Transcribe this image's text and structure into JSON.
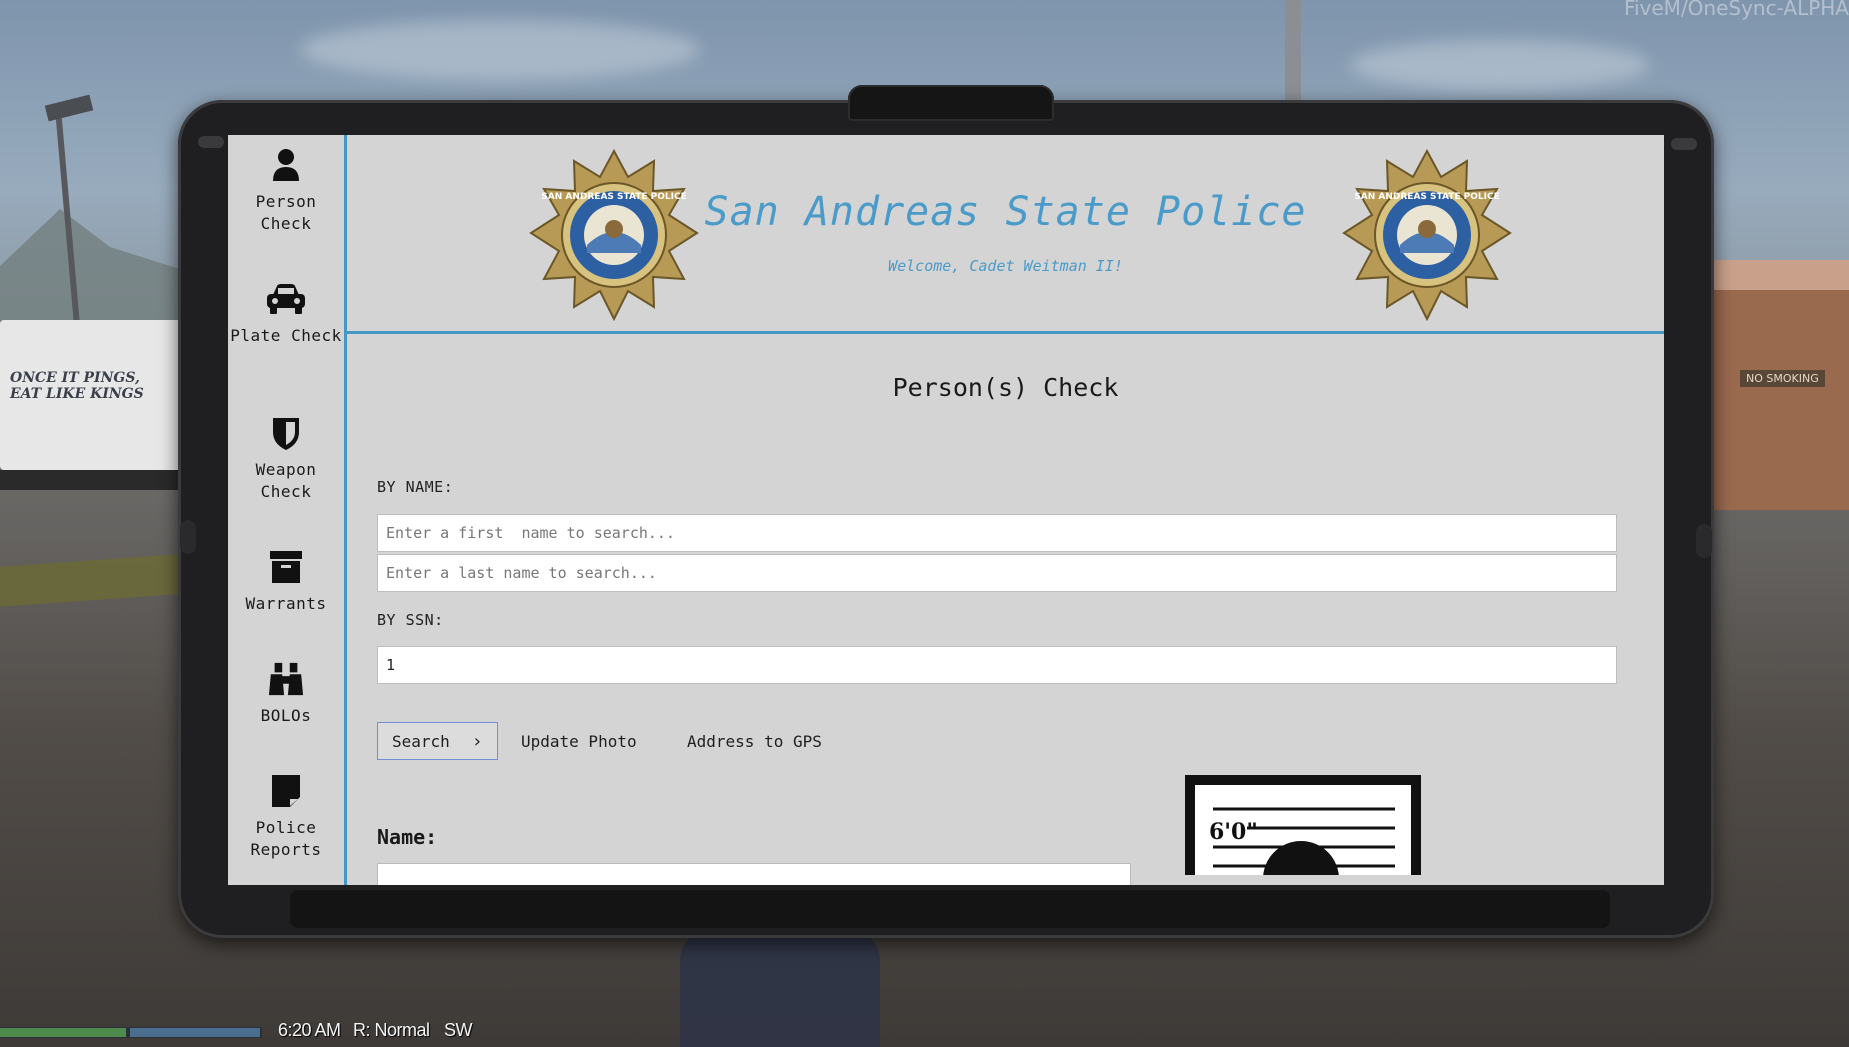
{
  "watermark": "FiveM/OneSync-ALPHA",
  "truck_text": [
    "ONCE IT PINGS,",
    "EAT LIKE KINGS"
  ],
  "shop_sign": "NO SMOKING",
  "hud": {
    "time": "6:20 AM",
    "voice": "R: Normal",
    "direction": "SW"
  },
  "sidebar": {
    "items": [
      {
        "label": "Person Check",
        "icon": "person-icon"
      },
      {
        "label": "Plate Check",
        "icon": "car-icon"
      },
      {
        "label": "Weapon Check",
        "icon": "shield-icon"
      },
      {
        "label": "Warrants",
        "icon": "archive-box-icon"
      },
      {
        "label": "BOLOs",
        "icon": "binoculars-icon"
      },
      {
        "label": "Police Reports",
        "icon": "sticky-note-icon"
      }
    ]
  },
  "header": {
    "title": "San Andreas State Police",
    "subtitle": "Welcome, Cadet Weitman II!",
    "badge_text": "SAN ANDREAS STATE POLICE",
    "accent_color": "#4a9bc9"
  },
  "main": {
    "page_title": "Person(s) Check",
    "by_name_label": "BY NAME:",
    "first_name_placeholder": "Enter a first  name to search...",
    "last_name_placeholder": "Enter a last name to search...",
    "by_ssn_label": "BY SSN:",
    "ssn_value": "1",
    "search_label": "Search",
    "update_photo_label": "Update Photo",
    "address_gps_label": "Address to GPS",
    "name_label": "Name:",
    "mugshot_height_mark": "6'0\""
  }
}
